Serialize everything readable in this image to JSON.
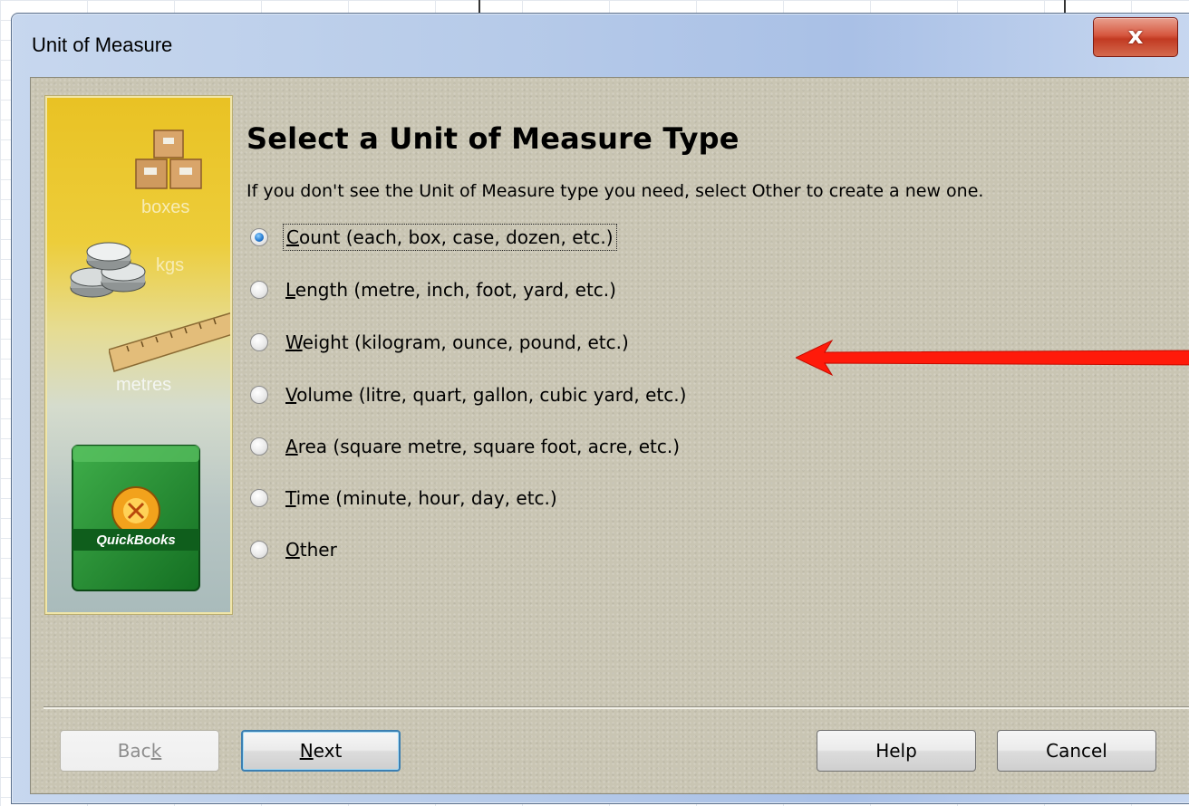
{
  "window": {
    "title": "Unit of Measure",
    "close_glyph": "x"
  },
  "side_panel": {
    "boxes_label": "boxes",
    "kgs_label": "kgs",
    "metres_label": "metres",
    "product_name": "QuickBooks"
  },
  "content": {
    "heading": "Select a Unit of Measure Type",
    "instructions": "If you don't see the Unit of Measure type you need, select Other to create a new one.",
    "selected_option": "Count",
    "options": [
      {
        "mnemonic": "C",
        "rest": "ount (each, box, case, dozen, etc.)"
      },
      {
        "mnemonic": "L",
        "rest": "ength (metre, inch, foot, yard, etc.)"
      },
      {
        "mnemonic": "W",
        "rest": "eight (kilogram, ounce, pound, etc.)"
      },
      {
        "mnemonic": "V",
        "rest": "olume (litre, quart, gallon, cubic yard, etc.)"
      },
      {
        "mnemonic": "A",
        "rest": "rea (square metre, square foot, acre, etc.)"
      },
      {
        "mnemonic": "T",
        "rest": "ime (minute, hour, day, etc.)"
      },
      {
        "mnemonic": "O",
        "rest": "ther"
      }
    ]
  },
  "buttons": {
    "back": {
      "before": "Bac",
      "mnemonic": "k",
      "disabled": true
    },
    "next": {
      "mnemonic": "N",
      "after": "ext",
      "default": true
    },
    "help": "Help",
    "cancel": "Cancel"
  },
  "colors": {
    "annotation_arrow": "#ff1a0a",
    "close_button": "#c94a30",
    "panel_top": "#e9c224",
    "product_box": "#1e8a2e"
  },
  "icons": {
    "boxes": "boxes-icon",
    "coins": "coins-icon",
    "ruler": "ruler-icon",
    "product": "quickbooks-box-icon",
    "annotation": "red-arrow-icon"
  }
}
